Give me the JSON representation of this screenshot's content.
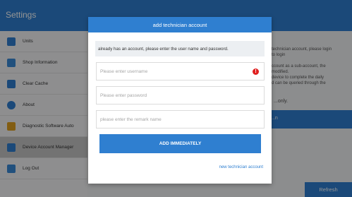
{
  "app": {
    "title": "Settings",
    "sidebar": [
      {
        "label": "Units",
        "icon": "units-icon",
        "color": "#2f7fd0"
      },
      {
        "label": "Shop Information",
        "icon": "shop-icon",
        "color": "#3a8ad8"
      },
      {
        "label": "Clear Cache",
        "icon": "trash-icon",
        "color": "#2f7fd0"
      },
      {
        "label": "About",
        "icon": "info-icon",
        "color": "#2f7fd0"
      },
      {
        "label": "Diagnostic Software Auto",
        "icon": "diagnostic-icon",
        "color": "#e0a020"
      },
      {
        "label": "Device Account Manager",
        "icon": "account-icon",
        "color": "#2f7fd0"
      },
      {
        "label": "Log Out",
        "icon": "logout-icon",
        "color": "#3a8ad8"
      }
    ],
    "info_lines": [
      "...technician account, please login",
      "...to login",
      "...ccount as a sub-account, the",
      "...modified.",
      "...device to complete the daily",
      "...d can be queried through the"
    ],
    "tail_text": "...only.",
    "panel_label": "...n",
    "refresh_label": "Refresh"
  },
  "dialog": {
    "title": "add technician account",
    "notice": "already has an account, please enter the user name and password.",
    "username_placeholder": "Please enter username",
    "password_placeholder": "Please enter password",
    "remark_placeholder": "please enter the remark name",
    "error_glyph": "!",
    "add_label": "ADD IMMEDIATELY",
    "new_link": "new technician account"
  },
  "colors": {
    "accent": "#2f7fd0",
    "error": "#e02020"
  }
}
